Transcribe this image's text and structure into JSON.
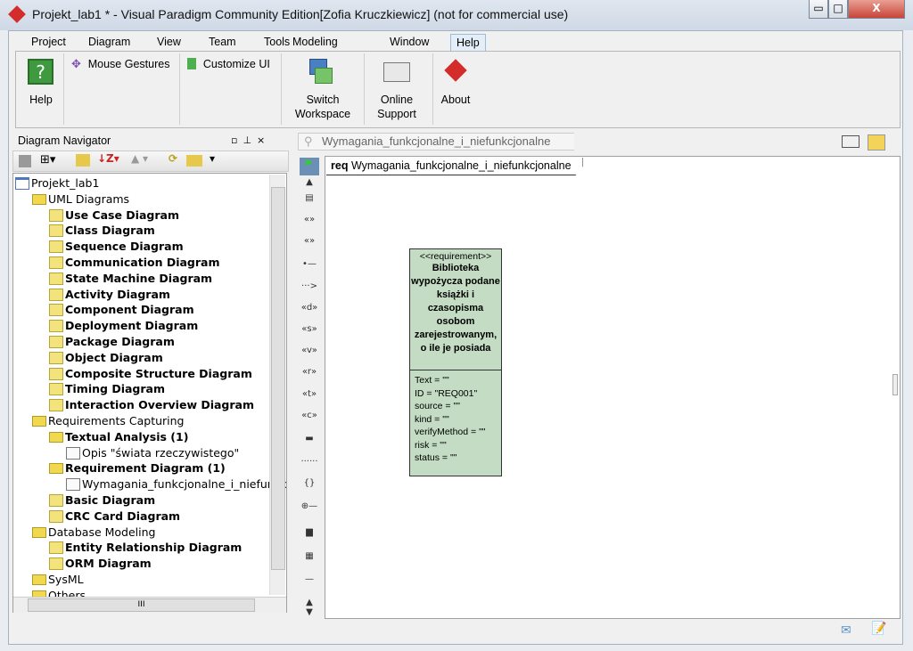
{
  "window": {
    "title": "Projekt_lab1 * - Visual Paradigm Community Edition[Zofia Kruczkiewicz] (not for commercial use)",
    "minimize": "▭",
    "maximize": "□",
    "close": "X"
  },
  "menu": [
    "Project",
    "Diagram",
    "View",
    "Team",
    "Tools",
    "Modeling",
    "Window",
    "Help"
  ],
  "ribbon": {
    "help": "Help",
    "mouse_gestures": "Mouse Gestures",
    "customize_ui": "Customize UI",
    "switch_workspace_1": "Switch",
    "switch_workspace_2": "Workspace",
    "online_support_1": "Online",
    "online_support_2": "Support",
    "about": "About"
  },
  "navigator": {
    "title": "Diagram Navigator",
    "tree": [
      {
        "label": "Projekt_lab1",
        "level": 0,
        "bold": false,
        "icon": "project"
      },
      {
        "label": "UML Diagrams",
        "level": 1,
        "bold": false,
        "icon": "folder"
      },
      {
        "label": "Use Case Diagram",
        "level": 2,
        "bold": true,
        "icon": "diagram"
      },
      {
        "label": "Class Diagram",
        "level": 2,
        "bold": true,
        "icon": "diagram"
      },
      {
        "label": "Sequence Diagram",
        "level": 2,
        "bold": true,
        "icon": "diagram"
      },
      {
        "label": "Communication Diagram",
        "level": 2,
        "bold": true,
        "icon": "diagram"
      },
      {
        "label": "State Machine Diagram",
        "level": 2,
        "bold": true,
        "icon": "diagram"
      },
      {
        "label": "Activity Diagram",
        "level": 2,
        "bold": true,
        "icon": "diagram"
      },
      {
        "label": "Component Diagram",
        "level": 2,
        "bold": true,
        "icon": "diagram"
      },
      {
        "label": "Deployment Diagram",
        "level": 2,
        "bold": true,
        "icon": "diagram"
      },
      {
        "label": "Package Diagram",
        "level": 2,
        "bold": true,
        "icon": "diagram"
      },
      {
        "label": "Object Diagram",
        "level": 2,
        "bold": true,
        "icon": "diagram"
      },
      {
        "label": "Composite Structure Diagram",
        "level": 2,
        "bold": true,
        "icon": "diagram"
      },
      {
        "label": "Timing Diagram",
        "level": 2,
        "bold": true,
        "icon": "diagram"
      },
      {
        "label": "Interaction Overview Diagram",
        "level": 2,
        "bold": true,
        "icon": "diagram"
      },
      {
        "label": "Requirements Capturing",
        "level": 1,
        "bold": false,
        "icon": "folder"
      },
      {
        "label": "Textual Analysis (1)",
        "level": 2,
        "bold": true,
        "icon": "folder"
      },
      {
        "label": "Opis \"świata rzeczywistego\"",
        "level": 3,
        "bold": false,
        "icon": "doc"
      },
      {
        "label": "Requirement Diagram (1)",
        "level": 2,
        "bold": true,
        "icon": "folder"
      },
      {
        "label": "Wymagania_funkcjonalne_i_niefunkcj",
        "level": 3,
        "bold": false,
        "icon": "doc"
      },
      {
        "label": "Basic Diagram",
        "level": 2,
        "bold": true,
        "icon": "diagram"
      },
      {
        "label": "CRC Card Diagram",
        "level": 2,
        "bold": true,
        "icon": "diagram"
      },
      {
        "label": "Database Modeling",
        "level": 1,
        "bold": false,
        "icon": "folder"
      },
      {
        "label": "Entity Relationship Diagram",
        "level": 2,
        "bold": true,
        "icon": "diagram"
      },
      {
        "label": "ORM Diagram",
        "level": 2,
        "bold": true,
        "icon": "diagram"
      },
      {
        "label": "SysML",
        "level": 1,
        "bold": false,
        "icon": "folder"
      },
      {
        "label": "Others",
        "level": 1,
        "bold": false,
        "icon": "folder"
      }
    ]
  },
  "breadcrumb": "Wymagania_funkcjonalne_i_niefunkcjonalne",
  "diagram": {
    "frame_kind": "req",
    "frame_name": "Wymagania_funkcjonalne_i_niefunkcjonalne",
    "requirement": {
      "stereotype": "<<requirement>>",
      "name": "Biblioteka wypożycza podane książki i czasopisma osobom zarejestrowanym, o ile je posiada",
      "props": [
        "Text = \"\"",
        "ID = \"REQ001\"",
        "source = \"\"",
        "kind = \"\"",
        "verifyMethod = \"\"",
        "risk = \"\"",
        "status = \"\""
      ]
    }
  },
  "palette": [
    "▶",
    "▲",
    "▤",
    "«»",
    "«»",
    "•—",
    "···>",
    "«d»",
    "«s»",
    "«v»",
    "«r»",
    "«t»",
    "«c»",
    "▬",
    "······",
    "{}",
    "⊕—",
    "▆",
    "▦",
    "—",
    "▲",
    "▼"
  ],
  "scroll_thumb": "III"
}
